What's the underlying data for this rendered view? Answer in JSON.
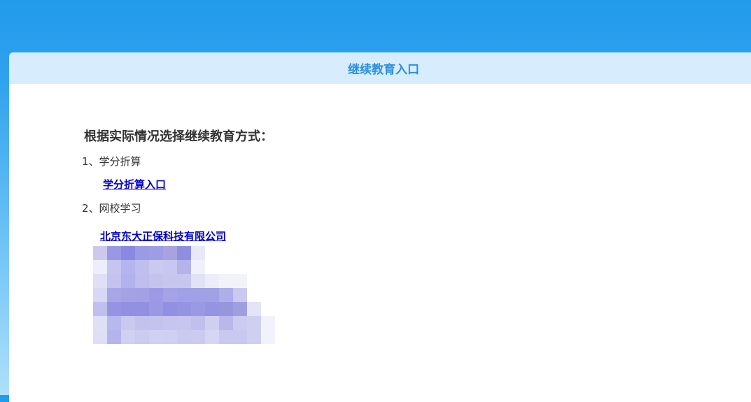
{
  "header": {
    "title": "继续教育入口"
  },
  "content": {
    "heading": "根据实际情况选择继续教育方式：",
    "option1": {
      "label": "1、学分折算",
      "link": "学分折算入口"
    },
    "option2": {
      "label": "2、网校学习",
      "link": "北京东大正保科技有限公司"
    }
  }
}
